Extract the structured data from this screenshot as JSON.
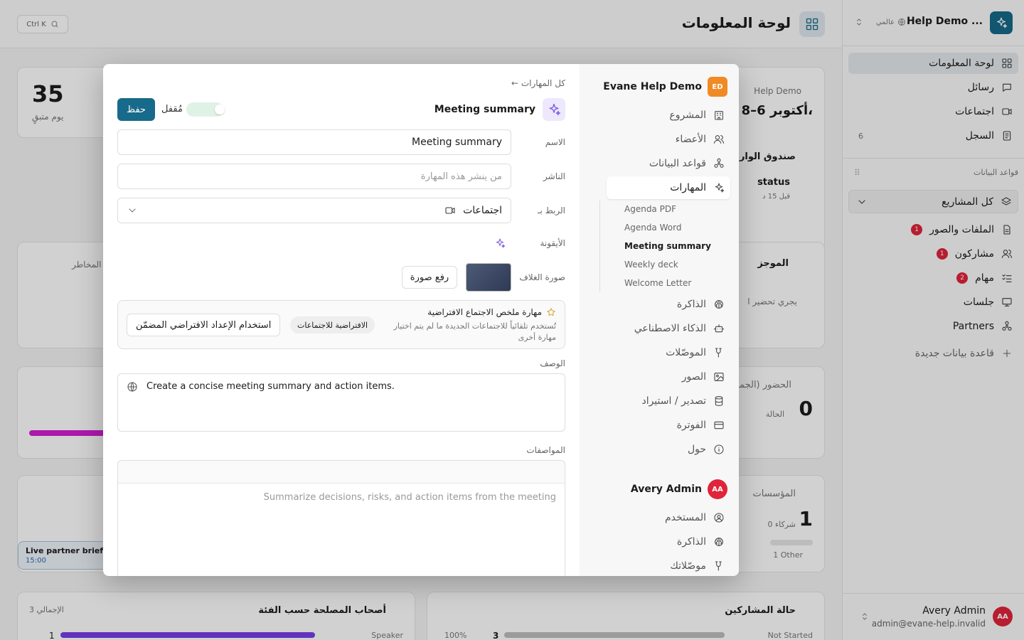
{
  "sidebar": {
    "workspace_name": "Help Demo ...",
    "workspace_scope": "عالمي",
    "nav": [
      {
        "label": "لوحة المعلومات",
        "icon": "dashboard-icon"
      },
      {
        "label": "رسائل",
        "icon": "message-icon"
      },
      {
        "label": "اجتماعات",
        "icon": "video-icon"
      },
      {
        "label": "السجل",
        "icon": "log-icon",
        "count": "6"
      }
    ],
    "databases_label": "قواعد البيانات",
    "all_projects": "كل المشاريع",
    "projects": [
      {
        "label": "الملفات والصور",
        "badge": "1",
        "icon": "file-icon"
      },
      {
        "label": "مشاركون",
        "badge": "1",
        "icon": "users-icon"
      },
      {
        "label": "مهام",
        "badge": "2",
        "icon": "tasks-icon"
      },
      {
        "label": "جلسات",
        "icon": "presentation-icon"
      },
      {
        "label": "Partners",
        "icon": "network-icon"
      }
    ],
    "new_database": "قاعدة بيانات جديدة",
    "user_name": "Avery Admin",
    "user_email": "admin@evane-help.invalid",
    "user_initials": "AA"
  },
  "main": {
    "title": "لوحة المعلومات",
    "search_shortcut": "Ctrl K",
    "stat_value": "35",
    "stat_label": "يوم متبقٍ",
    "demo_label": "Help Demo",
    "date_range": "أكتوبر 6–8،",
    "inbox_label": "صندوق الوارد",
    "status_label": "status",
    "ago_label": "قبل 15 د",
    "summary_label": "الموجز",
    "summary_text": "يجري تحضير ا",
    "risks_label": "المخاطر",
    "attendance_label": "الحضور (الجمه",
    "attendance_value": "0",
    "attendance_sub": "الحالة",
    "orgs_label": "المؤسسات",
    "orgs_value": "1",
    "orgs_sub": "0 شركاء",
    "orgs_other": "1 Other",
    "brief_title": "Live partner briefi",
    "brief_time": "15:00",
    "stakeholders_title": "أصحاب المصلحة حسب الفئة",
    "stakeholders_total": "3 الإجمالي",
    "stakeholders_row_label": "Speaker",
    "stakeholders_row_value": "1",
    "participants_title": "حالة المشاركين",
    "participants_row_label": "Not Started",
    "participants_row_value": "3",
    "participants_row_pct": "100%"
  },
  "modal": {
    "org_name": "Evane Help Demo",
    "org_initials": "ED",
    "nav": [
      {
        "label": "المشروع",
        "icon": "building-icon"
      },
      {
        "label": "الأعضاء",
        "icon": "users-icon"
      },
      {
        "label": "قواعد البيانات",
        "icon": "database-icon"
      },
      {
        "label": "المهارات",
        "icon": "sparkles-icon"
      }
    ],
    "skills": [
      "Agenda PDF",
      "Agenda Word",
      "Meeting summary",
      "Weekly deck",
      "Welcome Letter"
    ],
    "nav2": [
      {
        "label": "الذاكرة",
        "icon": "brain-icon"
      },
      {
        "label": "الذكاء الاصطناعي",
        "icon": "robot-icon"
      },
      {
        "label": "الموصّلات",
        "icon": "connector-icon"
      },
      {
        "label": "الصور",
        "icon": "image-icon"
      },
      {
        "label": "تصدير / استيراد",
        "icon": "export-icon"
      },
      {
        "label": "الفوترة",
        "icon": "card-icon"
      },
      {
        "label": "حول",
        "icon": "info-icon"
      }
    ],
    "user_name": "Avery Admin",
    "user_initials": "AA",
    "user_nav": [
      {
        "label": "المستخدم",
        "icon": "user-icon"
      },
      {
        "label": "الذاكرة",
        "icon": "brain-icon"
      },
      {
        "label": "موصّلاتك",
        "icon": "connector-icon"
      }
    ],
    "back": "← كل المهارات",
    "skill_name": "Meeting summary",
    "save": "حفظ",
    "locked": "مُقفل",
    "lbl_name": "الاسم",
    "name_value": "Meeting summary",
    "lbl_publisher": "الناشر",
    "publisher_placeholder": "من ينشر هذه المهارة",
    "lbl_link": "الربط بـ",
    "link_value": "اجتماعات",
    "lbl_icon": "الأيقونة",
    "lbl_cover": "صورة الغلاف",
    "upload": "رفع صورة",
    "default_title": "مهارة ملخص الاجتماع الافتراضية",
    "default_desc": "تُستخدم تلقائياً للاجتماعات الجديدة ما لم يتم اختيار مهارة أخرى",
    "default_tag": "الافتراضية للاجتماعات",
    "default_btn": "استخدام الإعداد الافتراضي المضمّن",
    "lbl_description": "الوصف",
    "description_value": "Create a concise meeting summary and action items.",
    "lbl_specs": "المواصفات",
    "specs_placeholder": "Summarize decisions, risks, and action items from the meeting"
  }
}
